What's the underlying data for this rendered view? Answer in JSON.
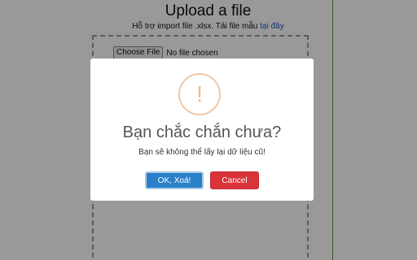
{
  "upload": {
    "title": "Upload a file",
    "subtitle": "Hỗ trợ import file .xlsx. Tải file mẫu",
    "template_link": "tại đây",
    "file_button": "Choose File",
    "file_status": "No file chosen"
  },
  "dialog": {
    "icon": "exclamation-icon",
    "icon_glyph": "!",
    "title": "Bạn chắc chắn chưa?",
    "message": "Bạn sẽ không thể lấy lại dữ liệu cũ!",
    "confirm_label": "OK, Xoá!",
    "cancel_label": "Cancel"
  },
  "colors": {
    "confirm": "#2b7fc8",
    "cancel": "#d8343a",
    "warning_icon": "#f3b98c"
  }
}
